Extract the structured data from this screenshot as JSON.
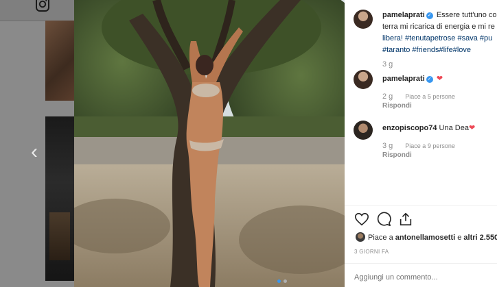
{
  "background": {
    "logo": "instagram-icon",
    "prev_arrow": "‹"
  },
  "photo": {
    "next_arrow": "›",
    "carousel_dots": 2,
    "active_dot": 0
  },
  "post": {
    "author": "pamelaprati",
    "caption_line1": "Essere tutt'uno co",
    "caption_line2": "terra mi ricarica di energia e mi re",
    "caption_line3": "libera! #tenutapetrose #sava #pu",
    "caption_line4": "#taranto #friends#life#love",
    "caption_time": "3 g"
  },
  "comments": [
    {
      "user": "pamelaprati",
      "verified": true,
      "text": "",
      "emoji": "❤",
      "time": "2 g",
      "likes": "Piace a 5 persone",
      "reply": "Rispondi"
    },
    {
      "user": "enzopiscopo74",
      "verified": false,
      "text": "Una Dea",
      "emoji": "❤",
      "time": "3 g",
      "likes": "Piace a 9 persone",
      "reply": "Rispondi"
    }
  ],
  "likes": {
    "prefix": "Piace a",
    "user": "antonellamosetti",
    "suffix": "e",
    "others": "altri 2.550"
  },
  "timestamp": "3 GIORNI FA",
  "add_comment_placeholder": "Aggiungi un commento...",
  "colors": {
    "link": "#003569",
    "verified": "#3897f0",
    "heart": "#ed4956",
    "meta": "#8e8e8e"
  }
}
